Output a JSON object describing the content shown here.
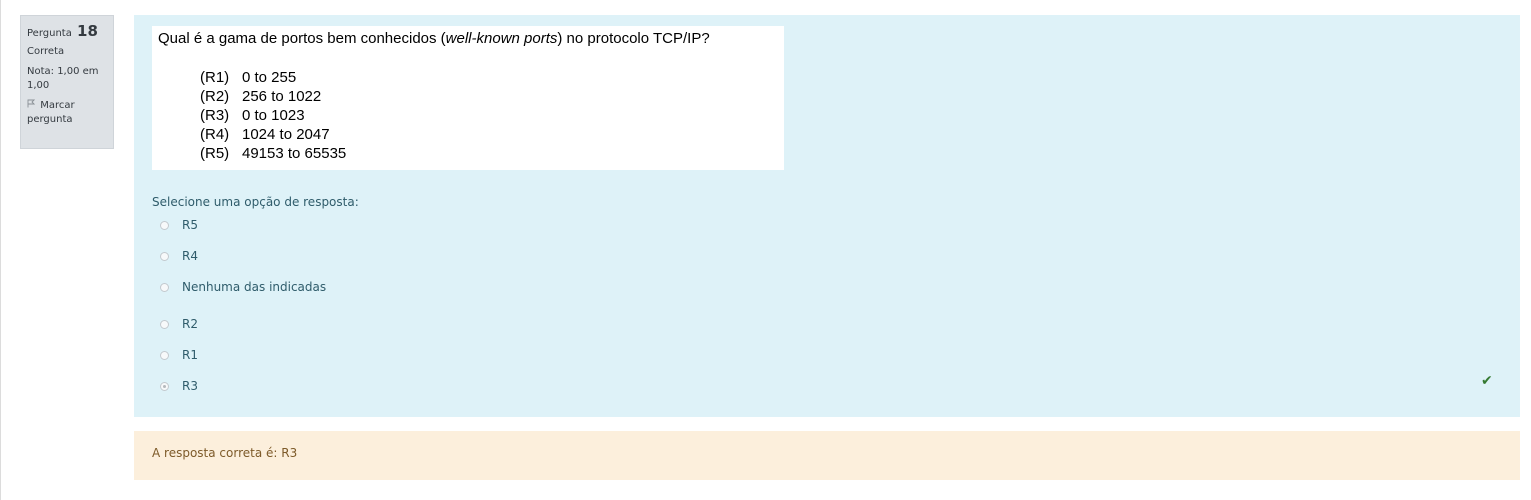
{
  "info": {
    "question_label": "Pergunta",
    "question_number": "18",
    "state": "Correta",
    "grade": "Nota: 1,00 em 1,00",
    "flag_label": "Marcar pergunta"
  },
  "question": {
    "title_before": "Qual é a gama de portos bem conhecidos (",
    "title_italic": "well-known ports",
    "title_after": ") no protocolo TCP/IP?",
    "choices": [
      {
        "tag": "(R1)",
        "text": "0 to 255"
      },
      {
        "tag": "(R2)",
        "text": "256 to 1022"
      },
      {
        "tag": "(R3)",
        "text": "0 to 1023"
      },
      {
        "tag": "(R4)",
        "text": "1024 to 2047"
      },
      {
        "tag": "(R5)",
        "text": "49153 to 65535"
      }
    ]
  },
  "answer": {
    "prompt": "Selecione uma opção de resposta:",
    "options": [
      {
        "label": "R5",
        "selected": false
      },
      {
        "label": "R4",
        "selected": false
      },
      {
        "label": "Nenhuma das indicadas",
        "selected": false
      },
      {
        "label": "R2",
        "selected": false
      },
      {
        "label": "R1",
        "selected": false
      },
      {
        "label": "R3",
        "selected": true
      }
    ],
    "status_icon": "check-icon"
  },
  "feedback": {
    "right_answer": "A resposta correta é: R3"
  },
  "colors": {
    "info_bg": "#dee2e6",
    "content_bg": "#def2f8",
    "feedback_bg": "#fcefdc",
    "correct_green": "#357a32"
  }
}
